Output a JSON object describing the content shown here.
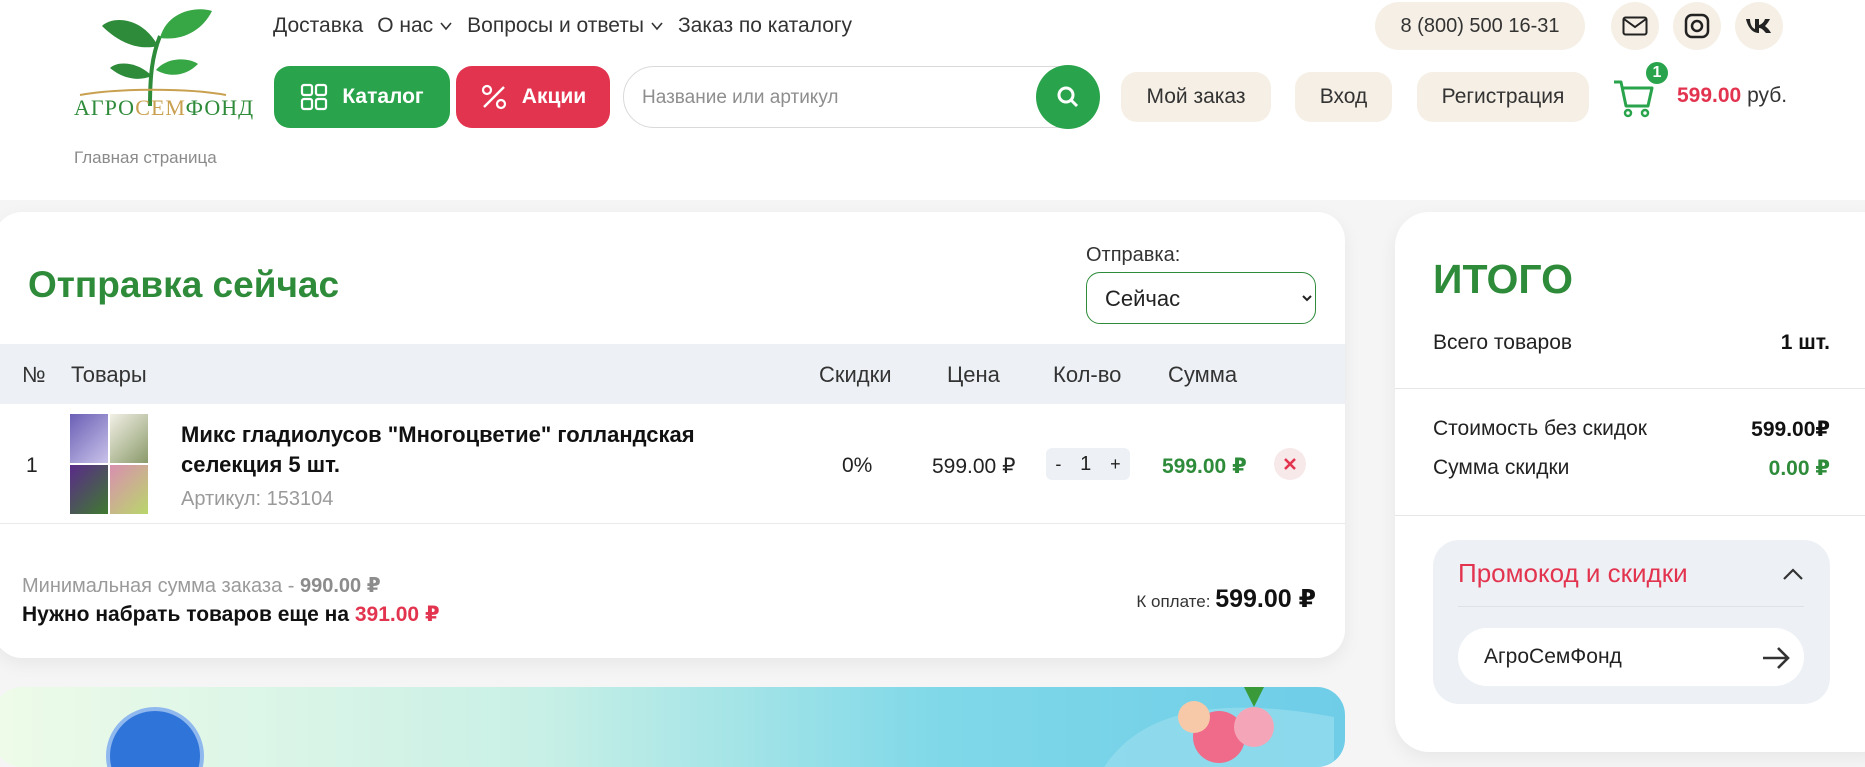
{
  "header": {
    "logo_text_a": "АГРО",
    "logo_text_b": "СЕМ",
    "logo_text_c": "ФОНД",
    "breadcrumb_home": "Главная страница",
    "nav": [
      {
        "label": "Доставка",
        "has_dropdown": false
      },
      {
        "label": "О нас",
        "has_dropdown": true
      },
      {
        "label": "Вопросы и ответы",
        "has_dropdown": true
      },
      {
        "label": "Заказ по каталогу",
        "has_dropdown": false
      }
    ],
    "phone": "8 (800) 500 16-31",
    "catalog_label": "Каталог",
    "sale_label": "Акции",
    "search_placeholder": "Название или артикул",
    "my_order_label": "Мой заказ",
    "login_label": "Вход",
    "register_label": "Регистрация",
    "cart_count": "1",
    "cart_amount": "599.00",
    "cart_currency": "руб."
  },
  "order": {
    "title": "Отправка сейчас",
    "shipping_label": "Отправка:",
    "shipping_options": [
      "Сейчас"
    ],
    "shipping_selected": "Сейчас",
    "columns": {
      "num": "№",
      "goods": "Товары",
      "discounts": "Скидки",
      "price": "Цена",
      "qty": "Кол-во",
      "sum": "Сумма"
    },
    "items": [
      {
        "num": "1",
        "name": "Микс гладиолусов \"Многоцветие\" голландская селекция 5 шт.",
        "sku": "Артикул: 153104",
        "discount": "0%",
        "price": "599.00 ₽",
        "qty": "1",
        "sum": "599.00 ₽"
      }
    ],
    "qty_minus": "-",
    "qty_plus": "+",
    "min_sum_text": "Минимальная сумма заказа - ",
    "min_sum_value": "990.00 ₽",
    "need_more_text": "Нужно набрать товаров еще на ",
    "need_more_value": "391.00 ₽",
    "to_pay_label": "К оплате:",
    "to_pay_value": "599.00 ₽"
  },
  "summary": {
    "title": "ИТОГО",
    "total_items_label": "Всего товаров",
    "total_items_value": "1 шт.",
    "cost_no_discount_label": "Стоимость без скидок",
    "cost_no_discount_value": "599.00₽",
    "discount_sum_label": "Сумма скидки",
    "discount_sum_value": "0.00 ₽",
    "promo_title": "Промокод и скидки",
    "promo_value": "АгроСемФонд"
  },
  "colors": {
    "brand_green": "#2aa44c",
    "accent_red": "#e3344f",
    "beige": "#f5efe5"
  }
}
